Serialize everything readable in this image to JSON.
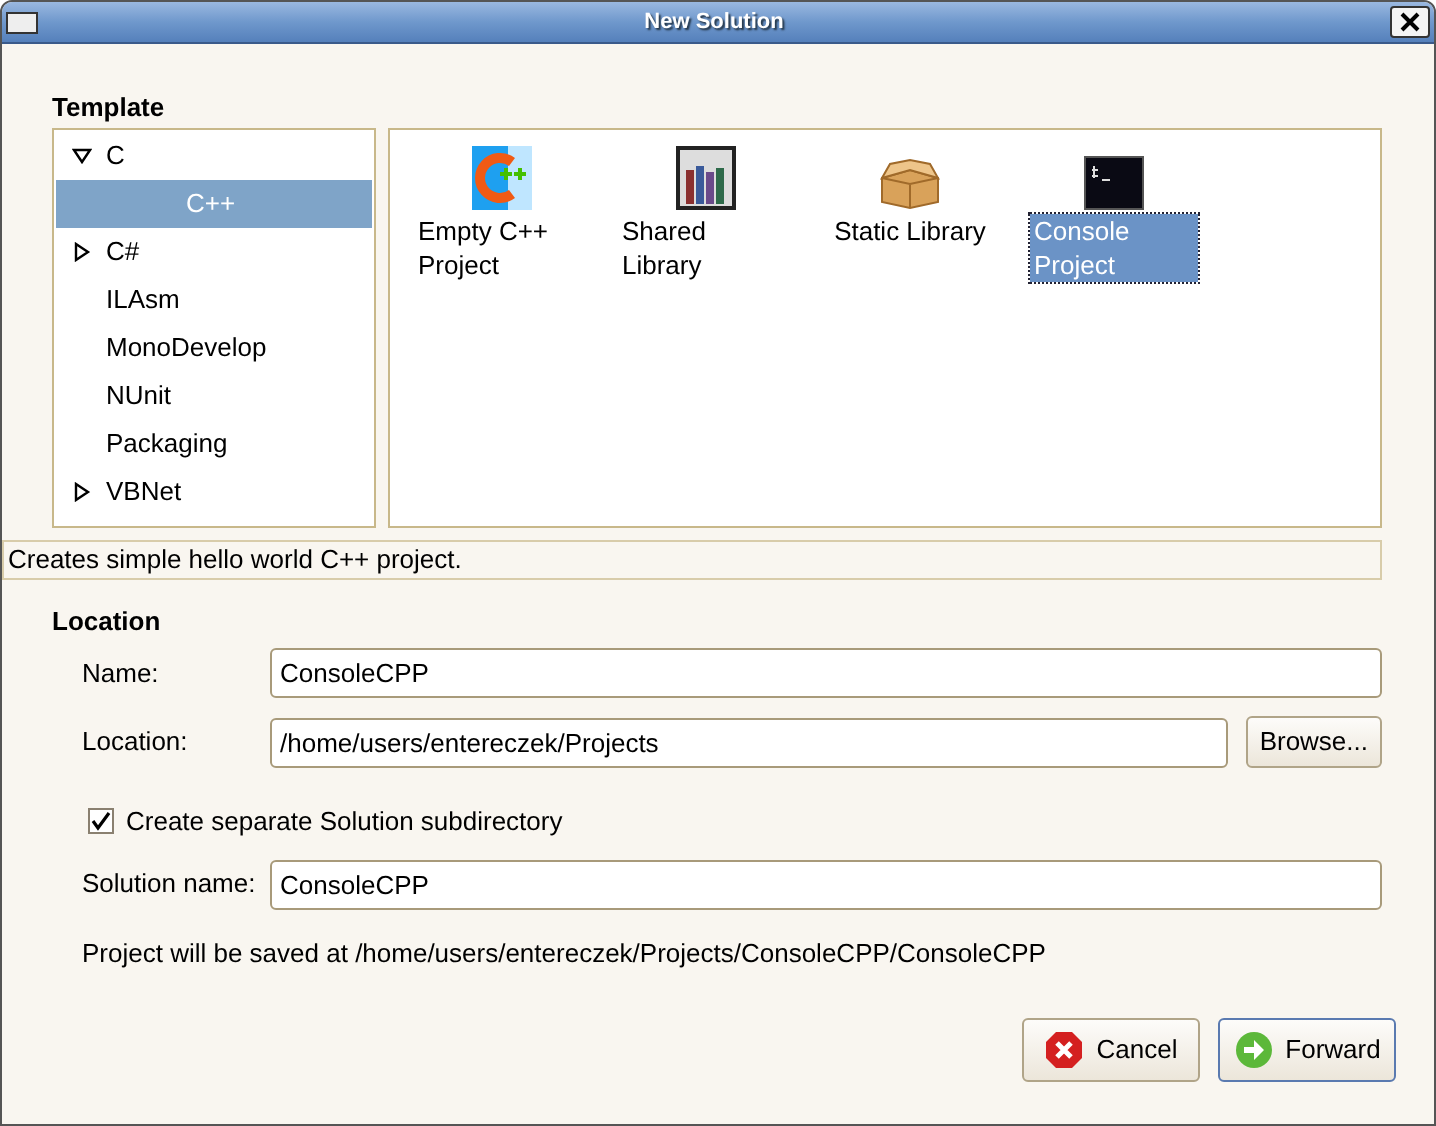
{
  "window": {
    "title": "New Solution"
  },
  "template": {
    "heading": "Template",
    "tree": [
      {
        "label": "C",
        "expanded": true,
        "selected": false,
        "children": [
          {
            "label": "C++",
            "selected": true
          }
        ]
      },
      {
        "label": "C#",
        "expanded": false,
        "selected": false
      },
      {
        "label": "ILAsm",
        "selected": false
      },
      {
        "label": "MonoDevelop",
        "selected": false
      },
      {
        "label": "NUnit",
        "selected": false
      },
      {
        "label": "Packaging",
        "selected": false
      },
      {
        "label": "VBNet",
        "expanded": false,
        "selected": false
      }
    ],
    "items": [
      {
        "label": "Empty C++ Project",
        "kind": "cpp",
        "selected": false
      },
      {
        "label": "Shared Library",
        "kind": "books",
        "selected": false
      },
      {
        "label": "Static Library",
        "kind": "box",
        "selected": false
      },
      {
        "label": "Console Project",
        "kind": "terminal",
        "selected": true
      }
    ],
    "description": "Creates simple hello world C++ project."
  },
  "location": {
    "heading": "Location",
    "name": {
      "label": "Name:",
      "value": "ConsoleCPP"
    },
    "path": {
      "label": "Location:",
      "value": "/home/users/entereczek/Projects"
    },
    "browse": "Browse...",
    "separate_dir": {
      "label": "Create separate Solution subdirectory",
      "checked": true
    },
    "solution_name": {
      "label": "Solution name:",
      "value": "ConsoleCPP"
    },
    "save_info": "Project will be saved at /home/users/entereczek/Projects/ConsoleCPP/ConsoleCPP"
  },
  "buttons": [
    {
      "label": "Cancel",
      "kind": "cancel"
    },
    {
      "label": "Forward",
      "kind": "forward"
    }
  ]
}
